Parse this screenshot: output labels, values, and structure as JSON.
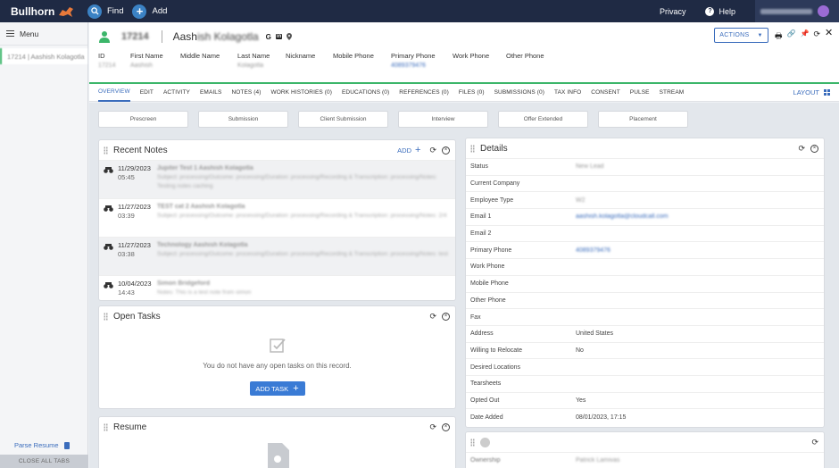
{
  "topbar": {
    "brand": "Bullhorn",
    "find_label": "Find",
    "add_label": "Add",
    "privacy_label": "Privacy",
    "help_label": "Help"
  },
  "sidebar": {
    "menu_label": "Menu",
    "recent_item": "17214 | Aashish Kolagotla",
    "parse_resume": "Parse Resume",
    "close_all": "CLOSE ALL TABS"
  },
  "record": {
    "id": "17214",
    "name_first": "Aash",
    "name_rest": "ish Kolagotla",
    "social": [
      "G",
      "in"
    ],
    "actions_label": "ACTIONS",
    "fields": {
      "labels": [
        "ID",
        "First Name",
        "Middle Name",
        "Last Name",
        "Nickname",
        "Mobile Phone",
        "Primary Phone",
        "Work Phone",
        "Other Phone"
      ],
      "values": [
        "17214",
        "Aashish",
        "",
        "Kolagotla",
        "",
        "",
        "4089379476",
        "",
        ""
      ]
    }
  },
  "tabs": {
    "items": [
      "OVERVIEW",
      "EDIT",
      "ACTIVITY",
      "EMAILS",
      "NOTES (4)",
      "WORK HISTORIES (0)",
      "EDUCATIONS (0)",
      "REFERENCES (0)",
      "FILES (0)",
      "SUBMISSIONS (0)",
      "TAX INFO",
      "CONSENT",
      "PULSE",
      "STREAM"
    ],
    "layout_label": "LAYOUT"
  },
  "stages": [
    "Prescreen",
    "Submission",
    "Client Submission",
    "Interview",
    "Offer Extended",
    "Placement"
  ],
  "recent_notes": {
    "title": "Recent Notes",
    "add_label": "ADD",
    "items": [
      {
        "date": "11/29/2023",
        "time": "05:45",
        "head": "Jupiter Test 1    Aashish Kolagotla",
        "text": "Subject: processing/Outcome: processing/Duration: processing/Recording & Transcription: processing/Notes: Testing notes caching"
      },
      {
        "date": "11/27/2023",
        "time": "03:39",
        "head": "TEST cat 2    Aashish Kolagotla",
        "text": "Subject: processing/Outcome: processing/Duration: processing/Recording & Transcription: processing/Notes: 2/4"
      },
      {
        "date": "11/27/2023",
        "time": "03:38",
        "head": "Technology    Aashish Kolagotla",
        "text": "Subject: processing/Outcome: processing/Duration: processing/Recording & Transcription: processing/Notes: test"
      },
      {
        "date": "10/04/2023",
        "time": "14:43",
        "head": "Simon Bridgeford",
        "text": "Notes: This is a test note from simon"
      }
    ]
  },
  "open_tasks": {
    "title": "Open Tasks",
    "empty_text": "You do not have any open tasks on this record.",
    "add_task_label": "ADD TASK"
  },
  "resume": {
    "title": "Resume"
  },
  "details": {
    "title": "Details",
    "rows": [
      {
        "label": "Status",
        "value": "New Lead",
        "style": "blur"
      },
      {
        "label": "Current Company",
        "value": "",
        "style": "plain"
      },
      {
        "label": "Employee Type",
        "value": "W2",
        "style": "blur"
      },
      {
        "label": "Email 1",
        "value": "aashish.kolagotla@cloudcall.com",
        "style": "link"
      },
      {
        "label": "Email 2",
        "value": "",
        "style": "plain"
      },
      {
        "label": "Primary Phone",
        "value": "4089379476",
        "style": "link"
      },
      {
        "label": "Work Phone",
        "value": "",
        "style": "plain"
      },
      {
        "label": "Mobile Phone",
        "value": "",
        "style": "plain"
      },
      {
        "label": "Other Phone",
        "value": "",
        "style": "plain"
      },
      {
        "label": "Fax",
        "value": "",
        "style": "plain"
      },
      {
        "label": "Address",
        "value": "United States",
        "style": "plain"
      },
      {
        "label": "Willing to Relocate",
        "value": "No",
        "style": "plain"
      },
      {
        "label": "Desired Locations",
        "value": "",
        "style": "plain"
      },
      {
        "label": "Tearsheets",
        "value": "",
        "style": "plain"
      },
      {
        "label": "Opted Out",
        "value": "Yes",
        "style": "plain"
      },
      {
        "label": "Date Added",
        "value": "08/01/2023, 17:15",
        "style": "plain"
      }
    ]
  },
  "ownership": {
    "label": "Ownership",
    "value": "Patrick Lamivas"
  },
  "colors": {
    "topbar": "#1f2a44",
    "accent": "#3a6cbc",
    "success": "#3cb66a"
  }
}
